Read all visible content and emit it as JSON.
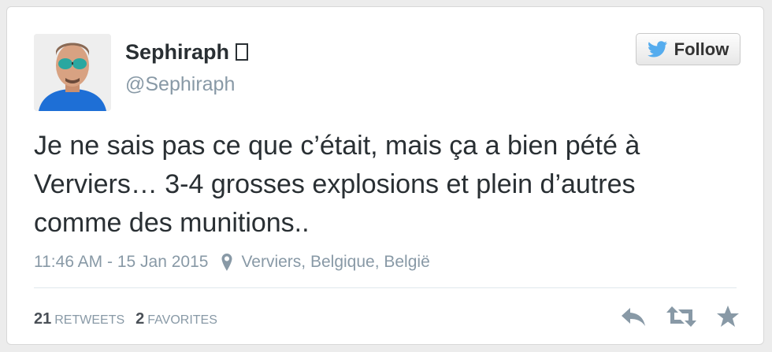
{
  "user": {
    "name": "Sephiraph",
    "verified_glyph": "▯",
    "handle": "@Sephiraph"
  },
  "follow_button": {
    "label": "Follow",
    "icon": "twitter-bird-icon",
    "color": "#55acee"
  },
  "tweet": {
    "text": "Je ne sais pas ce que c’était, mais ça a bien pété à Verviers… 3-4 grosses explosions et plein d’autres comme des munitions..",
    "timestamp": "11:46 AM - 15 Jan 2015",
    "location": "Verviers, Belgique, België"
  },
  "stats": {
    "retweets_count": "21",
    "retweets_label": "RETWEETS",
    "favorites_count": "2",
    "favorites_label": "FAVORITES"
  },
  "actions": [
    {
      "name": "reply",
      "icon": "reply-icon"
    },
    {
      "name": "retweet",
      "icon": "retweet-icon"
    },
    {
      "name": "favorite",
      "icon": "star-icon"
    }
  ],
  "colors": {
    "text": "#292f33",
    "muted": "#8899a6",
    "action_icon": "#8899a6",
    "bird": "#55acee"
  }
}
